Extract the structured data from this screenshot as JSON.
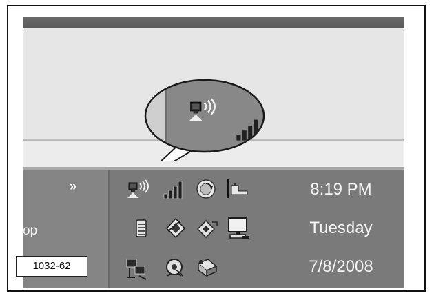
{
  "taskbar": {
    "quicklaunch_chevron": "»",
    "task_fragment": "op",
    "clock": {
      "time": "8:19 PM",
      "day": "Tuesday",
      "date": "7/8/2008"
    }
  },
  "tray_icons": [
    "wireless-network-icon",
    "signal-strength-icon",
    "update-icon",
    "power-plug-icon",
    "device-manager-icon",
    "security-shield-icon",
    "network-diamond-icon",
    "display-icon",
    "network-connections-icon",
    "media-icon",
    "printer-icon"
  ],
  "figure_label": "1032-62",
  "colors": {
    "taskbar": "#7a7a7a",
    "clock_text": "#f4f4f4"
  }
}
